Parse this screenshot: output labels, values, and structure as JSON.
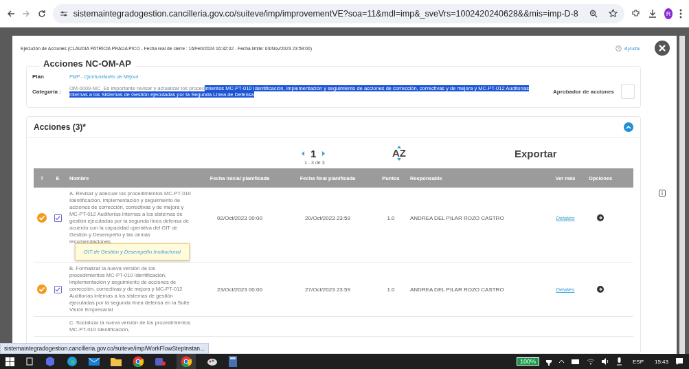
{
  "browser": {
    "url": "sistemaintegradogestion.cancilleria.gov.co/suiteve/imp/improvementVE?soa=11&mdl=imp&_sveVrs=1002420240628&&mis=imp-D-8",
    "profile_initial": "R"
  },
  "dialog": {
    "title": "Ejecución de Acciones (CLAUDIA PATRICIA PRADA PICO - Fecha real de cierre : 16/Feb/2024 16:32:02 - Fecha limite: 03/Nov/2023 23:59:00)",
    "help": "Ayuda"
  },
  "form": {
    "legend": "Acciones NC-OM-AP",
    "plan_label": "Plan",
    "plan_value": "PMP - Oportunidades de Mejora",
    "category_label": "Categoría :",
    "category_text": "OM-0009-MC_Es importante revisar y actualizar los proced",
    "category_selected_text": "imientos MC-PT-010 Identificación, implementación y seguimiento de acciones de corrección, correctivas y de mejora y MC-PT-012 Auditorías internas a los Sistemas de Gestión ejecutadas por la Segunda Línea de Defensa",
    "approver_label": "Aprobador de acciones"
  },
  "actions": {
    "title": "Acciones (3)*",
    "expanded": true,
    "page": "1",
    "range": "1 - 3 de 3",
    "sort": "AZ",
    "export": "Exportar",
    "columns": [
      "?",
      "E",
      "Nombre",
      "Fecha inicial planificada",
      "Fecha final planificada",
      "Puntos",
      "Responsable",
      "Ver más",
      "Opciones"
    ],
    "rows": [
      {
        "done": true,
        "checked": true,
        "name": "A. Revisar y adecuar los procedimientos MC-PT-010 Identificación, implementación y seguimiento de acciones de corrección, correctivas y de mejora y MC-PT-012 Auditorías internas a los sistemas de gestión ejecutadas por la segunda línea defensa de acuerdo con la capacidad operativa del GIT de Gestión y Desempeño y las demás recomendaciones",
        "start": "02/Oct/2023 00:00",
        "end": "20/Oct/2023 23:59",
        "points": "1.0",
        "owner": "ANDREA DEL PILAR ROZO CASTRO",
        "link": "Detalles"
      },
      {
        "done": true,
        "checked": true,
        "name": "B. Formalizar la nueva versión de los procedimientos MC-PT-010 Identificación, implementación y seguimiento de acciones de corrección, correctivas y de mejora y MC-PT-012 Auditorías internas a los sistemas de gestión ejecutadas por la segunda línea defensa en la Suite Visión Empresarial",
        "start": "23/Oct/2023 00:00",
        "end": "27/Oct/2023 23:59",
        "points": "1.0",
        "owner": "ANDREA DEL PILAR ROZO CASTRO",
        "link": "Detalles"
      },
      {
        "name": "C. Socializar la nueva versión de los procedimientos MC-PT-010 Identificación,"
      }
    ],
    "tooltip": "GIT de Gestión y Desempeño Institucional"
  },
  "status_url": "sistemaintegradogestion.cancilleria.gov.co/suiteve/imp/WorkFlowStepInstan...",
  "taskbar": {
    "battery": "100%",
    "language": "ESP",
    "time": "15:43"
  }
}
